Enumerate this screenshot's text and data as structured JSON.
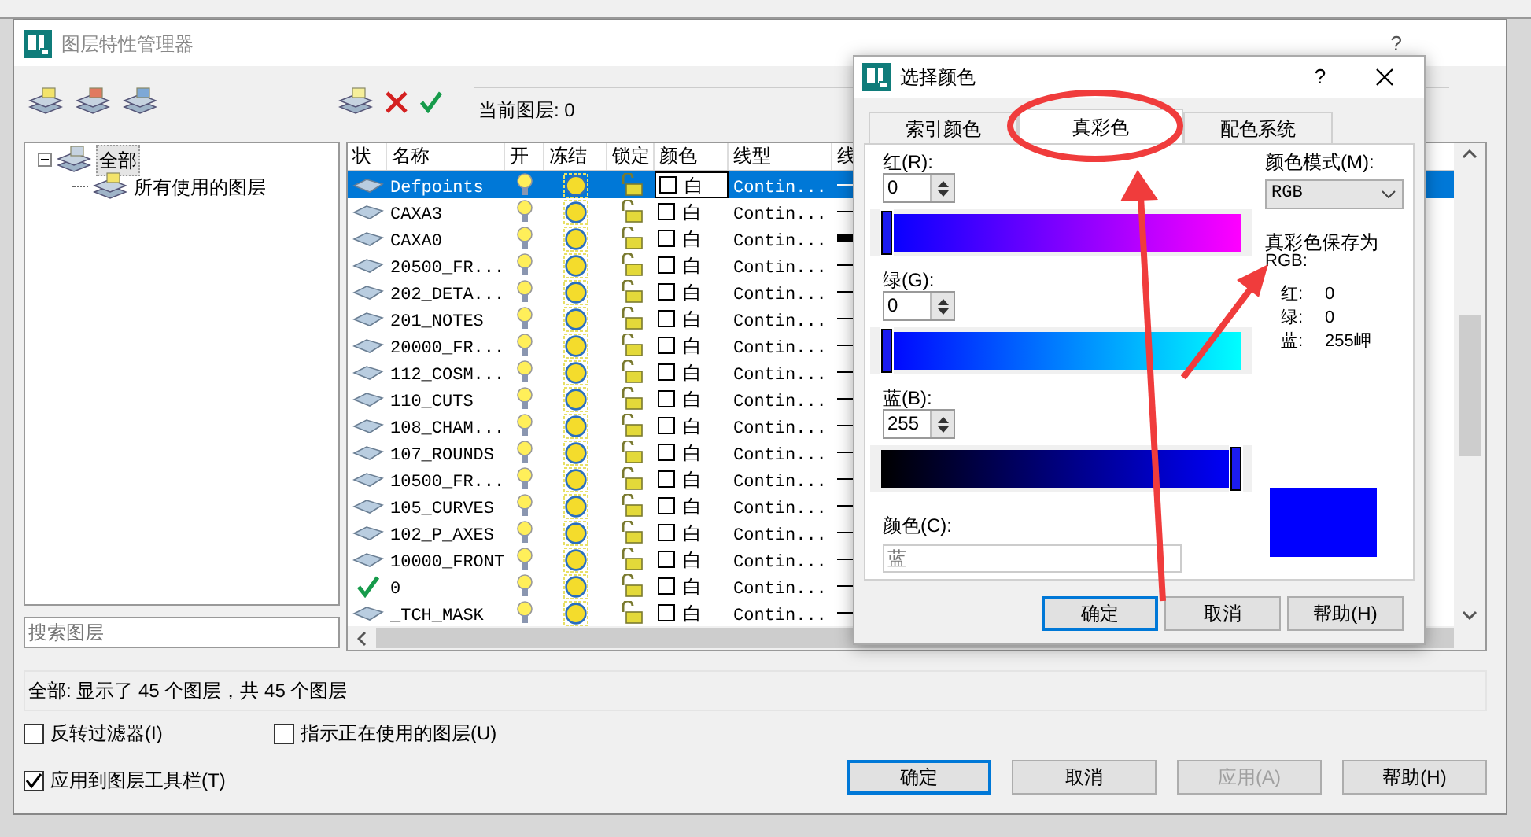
{
  "dialog": {
    "title": "图层特性管理器",
    "help": "?"
  },
  "current_layer": "当前图层: 0",
  "filter_tree": [
    {
      "label": "全部",
      "selected": true,
      "expanded": true,
      "children": [
        {
          "label": "所有使用的图层",
          "selected": false
        }
      ]
    }
  ],
  "search": {
    "placeholder": "搜索图层"
  },
  "table": {
    "columns": [
      "状",
      "名称",
      "开",
      "冻结",
      "锁定",
      "颜色",
      "线型",
      "线"
    ],
    "rows": [
      {
        "kind": "layer",
        "name": "Defpoints",
        "selected": true,
        "on": true,
        "frozen": false,
        "locked": false,
        "color_name": "白",
        "linetype": "Contin...",
        "heavy_line": false
      },
      {
        "kind": "layer",
        "name": "CAXA3",
        "selected": false,
        "on": true,
        "frozen": false,
        "locked": false,
        "color_name": "白",
        "linetype": "Contin...",
        "heavy_line": false
      },
      {
        "kind": "layer",
        "name": "CAXA0",
        "selected": false,
        "on": true,
        "frozen": false,
        "locked": false,
        "color_name": "白",
        "linetype": "Contin...",
        "heavy_line": true
      },
      {
        "kind": "layer",
        "name": "20500_FR...",
        "selected": false,
        "on": true,
        "frozen": false,
        "locked": false,
        "color_name": "白",
        "linetype": "Contin...",
        "heavy_line": false
      },
      {
        "kind": "layer",
        "name": "202_DETA...",
        "selected": false,
        "on": true,
        "frozen": false,
        "locked": false,
        "color_name": "白",
        "linetype": "Contin...",
        "heavy_line": false
      },
      {
        "kind": "layer",
        "name": "201_NOTES",
        "selected": false,
        "on": true,
        "frozen": false,
        "locked": false,
        "color_name": "白",
        "linetype": "Contin...",
        "heavy_line": false
      },
      {
        "kind": "layer",
        "name": "20000_FR...",
        "selected": false,
        "on": true,
        "frozen": false,
        "locked": false,
        "color_name": "白",
        "linetype": "Contin...",
        "heavy_line": false
      },
      {
        "kind": "layer",
        "name": "112_COSM...",
        "selected": false,
        "on": true,
        "frozen": false,
        "locked": false,
        "color_name": "白",
        "linetype": "Contin...",
        "heavy_line": false
      },
      {
        "kind": "layer",
        "name": "110_CUTS",
        "selected": false,
        "on": true,
        "frozen": false,
        "locked": false,
        "color_name": "白",
        "linetype": "Contin...",
        "heavy_line": false
      },
      {
        "kind": "layer",
        "name": "108_CHAM...",
        "selected": false,
        "on": true,
        "frozen": false,
        "locked": false,
        "color_name": "白",
        "linetype": "Contin...",
        "heavy_line": false
      },
      {
        "kind": "layer",
        "name": "107_ROUNDS",
        "selected": false,
        "on": true,
        "frozen": false,
        "locked": false,
        "color_name": "白",
        "linetype": "Contin...",
        "heavy_line": false
      },
      {
        "kind": "layer",
        "name": "10500_FR...",
        "selected": false,
        "on": true,
        "frozen": false,
        "locked": false,
        "color_name": "白",
        "linetype": "Contin...",
        "heavy_line": false
      },
      {
        "kind": "layer",
        "name": "105_CURVES",
        "selected": false,
        "on": true,
        "frozen": false,
        "locked": false,
        "color_name": "白",
        "linetype": "Contin...",
        "heavy_line": false
      },
      {
        "kind": "layer",
        "name": "102_P_AXES",
        "selected": false,
        "on": true,
        "frozen": false,
        "locked": false,
        "color_name": "白",
        "linetype": "Contin...",
        "heavy_line": false
      },
      {
        "kind": "layer",
        "name": "10000_FRONT",
        "selected": false,
        "on": true,
        "frozen": false,
        "locked": false,
        "color_name": "白",
        "linetype": "Contin...",
        "heavy_line": false
      },
      {
        "kind": "current",
        "name": "0",
        "selected": false,
        "on": true,
        "frozen": false,
        "locked": false,
        "color_name": "白",
        "linetype": "Contin...",
        "heavy_line": false
      },
      {
        "kind": "layer",
        "name": "_TCH_MASK",
        "selected": false,
        "on": true,
        "frozen": false,
        "locked": false,
        "color_name": "白",
        "linetype": "Contin...",
        "heavy_line": false
      }
    ]
  },
  "status": "全部: 显示了 45 个图层，共 45 个图层",
  "options": [
    {
      "label": "反转过滤器(I)",
      "checked": false
    },
    {
      "label": "指示正在使用的图层(U)",
      "checked": false
    },
    {
      "label": "应用到图层工具栏(T)",
      "checked": true
    }
  ],
  "buttons": [
    {
      "label": "确定",
      "default": true,
      "disabled": false
    },
    {
      "label": "取消",
      "default": false,
      "disabled": false
    },
    {
      "label": "应用(A)",
      "default": false,
      "disabled": true
    },
    {
      "label": "帮助(H)",
      "default": false,
      "disabled": false
    }
  ],
  "color_dialog": {
    "title": "选择颜色",
    "help": "?",
    "tabs": [
      {
        "label": "索引颜色",
        "selected": false
      },
      {
        "label": "真彩色",
        "selected": true
      },
      {
        "label": "配色系统",
        "selected": false
      }
    ],
    "channels": [
      {
        "kind": "red",
        "label": "红(R):",
        "value": "0",
        "level": 0
      },
      {
        "kind": "green",
        "label": "绿(G):",
        "value": "0",
        "level": 0
      },
      {
        "kind": "blue",
        "label": "蓝(B):",
        "value": "255",
        "level": 1
      }
    ],
    "color_label": "颜色(C):",
    "color_value": "蓝",
    "mode_label": "颜色模式(M):",
    "mode_value": "RGB",
    "saved_as_label": "真彩色保存为",
    "saved_as_sub": "RGB:",
    "saved": [
      {
        "label": "红:",
        "value": "0"
      },
      {
        "label": "绿:",
        "value": "0"
      },
      {
        "label": "蓝:",
        "value": "255岬"
      }
    ],
    "buttons": [
      {
        "label": "确定",
        "default": true,
        "disabled": false
      },
      {
        "label": "取消",
        "default": false,
        "disabled": false
      },
      {
        "label": "帮助(H)",
        "default": false,
        "disabled": false
      }
    ]
  }
}
